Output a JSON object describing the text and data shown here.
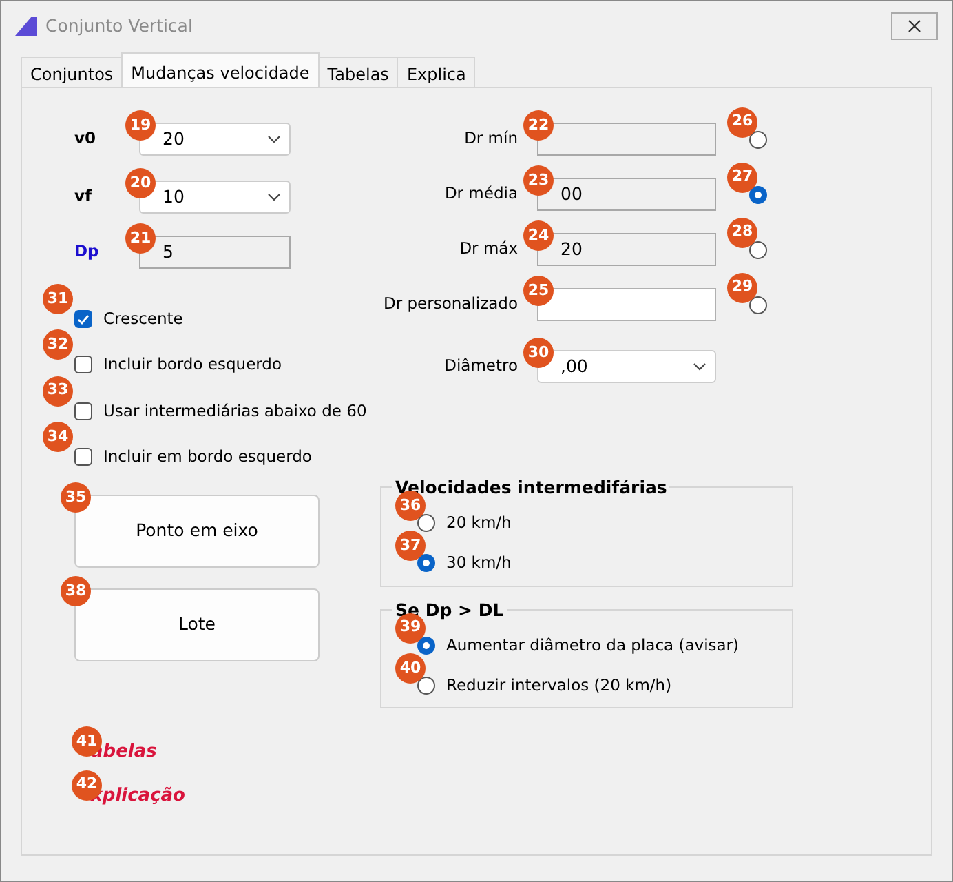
{
  "window": {
    "title": "Conjunto Vertical"
  },
  "tabs": [
    {
      "label": "Conjuntos",
      "selected": false
    },
    {
      "label": "Mudanças velocidade",
      "selected": true
    },
    {
      "label": "Tabelas",
      "selected": false
    },
    {
      "label": "Explica",
      "selected": false
    }
  ],
  "left_fields": [
    {
      "label": "v0",
      "color": "#000000",
      "kind": "select",
      "value": "20",
      "badge": "19"
    },
    {
      "label": "vf",
      "color": "#000000",
      "kind": "select",
      "value": "10",
      "badge": "20"
    },
    {
      "label": "Dp",
      "color": "#1c0ecf",
      "kind": "readonly",
      "value": "5",
      "badge": "21"
    }
  ],
  "right_fields": [
    {
      "label": "Dr mín",
      "kind": "readonly",
      "badge": "22",
      "radio": {
        "badge": "26",
        "selected": false
      }
    },
    {
      "label": "Dr média",
      "kind": "readonly",
      "value": "00",
      "badge": "23",
      "radio": {
        "badge": "27",
        "selected": true
      }
    },
    {
      "label": "Dr máx",
      "kind": "readonly",
      "value": "20",
      "badge": "24",
      "radio": {
        "badge": "28",
        "selected": false
      }
    },
    {
      "label": "Dr personalizado",
      "kind": "text",
      "badge": "25",
      "radio": {
        "badge": "29",
        "selected": false
      }
    },
    {
      "label": "Diâmetro",
      "kind": "select",
      "value": ",00",
      "badge": "30"
    }
  ],
  "checkboxes": [
    {
      "label": "Crescente",
      "checked": true,
      "badge": "31"
    },
    {
      "label": "Incluir bordo esquerdo",
      "checked": false,
      "badge": "32"
    },
    {
      "label": "Usar intermediárias abaixo de 60",
      "checked": false,
      "badge": "33"
    },
    {
      "label": "Incluir em bordo esquerdo",
      "checked": false,
      "badge": "34"
    }
  ],
  "buttons": [
    {
      "label": "Ponto em eixo",
      "badge": "35"
    },
    {
      "label": "Lote",
      "badge": "38"
    }
  ],
  "groups": [
    {
      "title": "Velocidades intermedifárias",
      "options": [
        {
          "label": "20 km/h",
          "selected": false,
          "badge": "36"
        },
        {
          "label": "30 km/h",
          "selected": true,
          "badge": "37"
        }
      ]
    },
    {
      "title": "Se Dp > DL",
      "options": [
        {
          "label": "Aumentar diâmetro da placa (avisar)",
          "selected": true,
          "badge": "39"
        },
        {
          "label": "Reduzir intervalos (20 km/h)",
          "selected": false,
          "badge": "40"
        }
      ]
    }
  ],
  "links": [
    {
      "label": "abelas",
      "badge": "41"
    },
    {
      "label": "xplicação",
      "badge": "42"
    }
  ]
}
